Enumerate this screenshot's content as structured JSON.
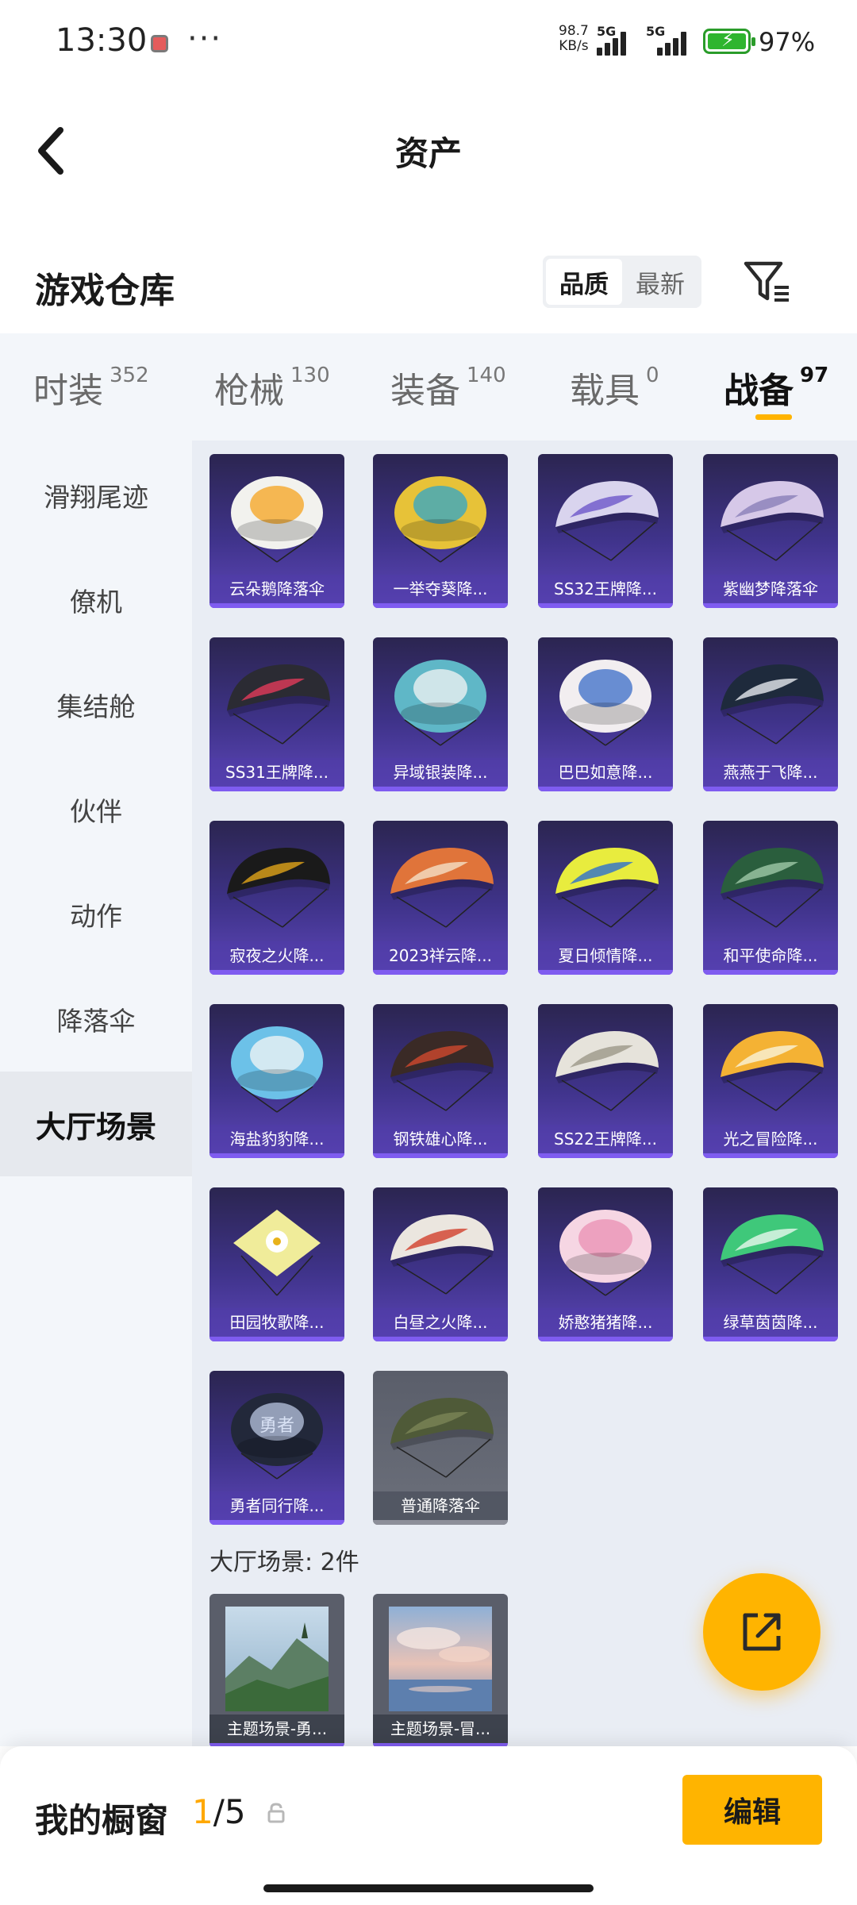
{
  "status_bar": {
    "time": "13:30",
    "more": "···",
    "speed_value": "98.7",
    "speed_unit": "KB/s",
    "network_1": "5G",
    "network_2": "5G",
    "battery": "97%"
  },
  "header": {
    "title": "资产"
  },
  "warehouse": {
    "title": "游戏仓库",
    "sort_options": [
      "品质",
      "最新"
    ],
    "active_sort": "品质"
  },
  "categories": [
    {
      "name": "时装",
      "count": "352"
    },
    {
      "name": "枪械",
      "count": "130"
    },
    {
      "name": "装备",
      "count": "140"
    },
    {
      "name": "载具",
      "count": "0"
    },
    {
      "name": "战备",
      "count": "97"
    }
  ],
  "active_category": "战备",
  "side_nav": [
    {
      "label": "滑翔尾迹"
    },
    {
      "label": "僚机"
    },
    {
      "label": "集结舱"
    },
    {
      "label": "伙伴"
    },
    {
      "label": "动作"
    },
    {
      "label": "降落伞"
    },
    {
      "label": "大厅场景"
    }
  ],
  "active_side": "大厅场景",
  "parachutes": [
    {
      "name": "云朵鹅降落伞",
      "canopy": "#f2f2ee",
      "accent": "#f5a31d",
      "shape": "round"
    },
    {
      "name": "一举夺葵降...",
      "canopy": "#e7c238",
      "accent": "#2fa6c9",
      "shape": "round"
    },
    {
      "name": "SS32王牌降...",
      "canopy": "#d9d4ee",
      "accent": "#6d56c9",
      "shape": "wing"
    },
    {
      "name": "紫幽梦降落伞",
      "canopy": "#d6c8e8",
      "accent": "#8a7fb8",
      "shape": "wing"
    },
    {
      "name": "SS31王牌降...",
      "canopy": "#2b2b33",
      "accent": "#e23b5a",
      "shape": "wing"
    },
    {
      "name": "异域银装降...",
      "canopy": "#5fb7c7",
      "accent": "#f4f4f4",
      "shape": "round"
    },
    {
      "name": "巴巴如意降...",
      "canopy": "#f2eef0",
      "accent": "#3a6cc8",
      "shape": "round"
    },
    {
      "name": "燕燕于飞降...",
      "canopy": "#1e2a3c",
      "accent": "#e5e8ee",
      "shape": "wing"
    },
    {
      "name": "寂夜之火降...",
      "canopy": "#1a1a1a",
      "accent": "#e0a419",
      "shape": "wing"
    },
    {
      "name": "2023祥云降...",
      "canopy": "#e0743a",
      "accent": "#f4e0c7",
      "shape": "wing"
    },
    {
      "name": "夏日倾情降...",
      "canopy": "#e8ec3e",
      "accent": "#2c6fce",
      "shape": "wing"
    },
    {
      "name": "和平使命降...",
      "canopy": "#2a5e3d",
      "accent": "#9fc8a8",
      "shape": "wing"
    },
    {
      "name": "海盐豹豹降...",
      "canopy": "#6cc1e8",
      "accent": "#f5f5f5",
      "shape": "round"
    },
    {
      "name": "钢铁雄心降...",
      "canopy": "#3a2a26",
      "accent": "#d0482e",
      "shape": "wing"
    },
    {
      "name": "SS22王牌降...",
      "canopy": "#e6e3db",
      "accent": "#9c9788",
      "shape": "wing"
    },
    {
      "name": "光之冒险降...",
      "canopy": "#f4b234",
      "accent": "#f9f2da",
      "shape": "wing"
    },
    {
      "name": "田园牧歌降...",
      "canopy": "#f0ec9a",
      "accent": "#ffffff",
      "shape": "square"
    },
    {
      "name": "白昼之火降...",
      "canopy": "#ebe6df",
      "accent": "#d2402c",
      "shape": "wing"
    },
    {
      "name": "娇憨猪猪降...",
      "canopy": "#f6d6e3",
      "accent": "#e98fb3",
      "shape": "round"
    },
    {
      "name": "绿草茵茵降...",
      "canopy": "#3fc87a",
      "accent": "#e9f8ee",
      "shape": "wing"
    },
    {
      "name": "勇者同行降...",
      "canopy": "#22283a",
      "accent": "#b9c6e2",
      "shape": "round",
      "mark": "勇者"
    },
    {
      "name": "普通降落伞",
      "canopy": "#4f5a38",
      "accent": "#7a8556",
      "shape": "wing",
      "rarity": "common"
    }
  ],
  "lobby_scenes": {
    "heading": "大厅场景: 2件",
    "items": [
      {
        "name": "主题场景-勇...",
        "sky": "#b5cde0",
        "ground": "#3b6a3a"
      },
      {
        "name": "主题场景-冒...",
        "sky": "#9fb9d8",
        "ground": "#e9b6a6"
      }
    ]
  },
  "showcase": {
    "label": "我的橱窗",
    "current": "1",
    "total": "/5",
    "edit": "编辑"
  },
  "colors": {
    "accent": "#ffb400",
    "card_purple": "#3f338a"
  }
}
